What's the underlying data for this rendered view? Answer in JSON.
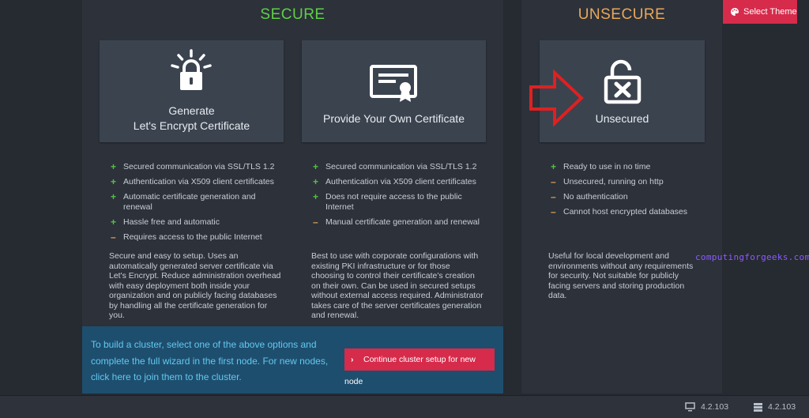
{
  "secure": {
    "title": "SECURE",
    "cards": [
      {
        "line1": "Generate",
        "line2": "Let's Encrypt Certificate",
        "icon": "lock-sparkle-icon"
      },
      {
        "line1": "Provide Your Own Certificate",
        "icon": "certificate-icon"
      }
    ],
    "lists": [
      [
        {
          "type": "plus",
          "text": "Secured communication via SSL/TLS 1.2"
        },
        {
          "type": "plus",
          "text": "Authentication via X509 client certificates"
        },
        {
          "type": "plus",
          "text": "Automatic certificate generation and renewal"
        },
        {
          "type": "plus",
          "text": "Hassle free and automatic"
        },
        {
          "type": "minus",
          "text": "Requires access to the public Internet"
        }
      ],
      [
        {
          "type": "plus",
          "text": "Secured communication via SSL/TLS 1.2"
        },
        {
          "type": "plus",
          "text": "Authentication via X509 client certificates"
        },
        {
          "type": "plus",
          "text": "Does not require access to the public Internet"
        },
        {
          "type": "minus",
          "text": "Manual certificate generation and renewal"
        }
      ]
    ],
    "descriptions": [
      "Secure and easy to setup. Uses an automatically generated server certificate via Let's Encrypt. Reduce administration overhead with easy deployment both inside your organization and on publicly facing databases by handling all the certificate generation for you.",
      "Best to use with corporate configurations with existing PKI infrastructure or for those choosing to control their certificate's creation on their own. Can be used in secured setups without external access required. Administrator takes care of the server certificates generation and renewal."
    ]
  },
  "unsecure": {
    "title": "UNSECURE",
    "card": {
      "label": "Unsecured",
      "icon": "open-lock-x-icon"
    },
    "list": [
      {
        "type": "plus",
        "text": "Ready to use in no time"
      },
      {
        "type": "minus",
        "text": "Unsecured, running on http"
      },
      {
        "type": "minus",
        "text": "No authentication"
      },
      {
        "type": "minus",
        "text": "Cannot host encrypted databases"
      }
    ],
    "description": "Useful for local development and environments without any requirements for security. Not suitable for publicly facing servers and storing production data."
  },
  "cluster": {
    "text": "To build a cluster, select one of the above options and complete the full wizard in the first node. For new nodes, click here to join them to the cluster.",
    "button": "Continue cluster setup for new node"
  },
  "select_theme": "Select Theme",
  "watermark": "computingforgeeks.com",
  "status": {
    "version_left": "4.2.103",
    "version_right": "4.2.103"
  },
  "colors": {
    "secure": "#5fcf47",
    "unsecure": "#e8a85a",
    "accent": "#d62b4b",
    "plus": "#55c040",
    "minus": "#e0a060",
    "arrow": "#e02020"
  }
}
